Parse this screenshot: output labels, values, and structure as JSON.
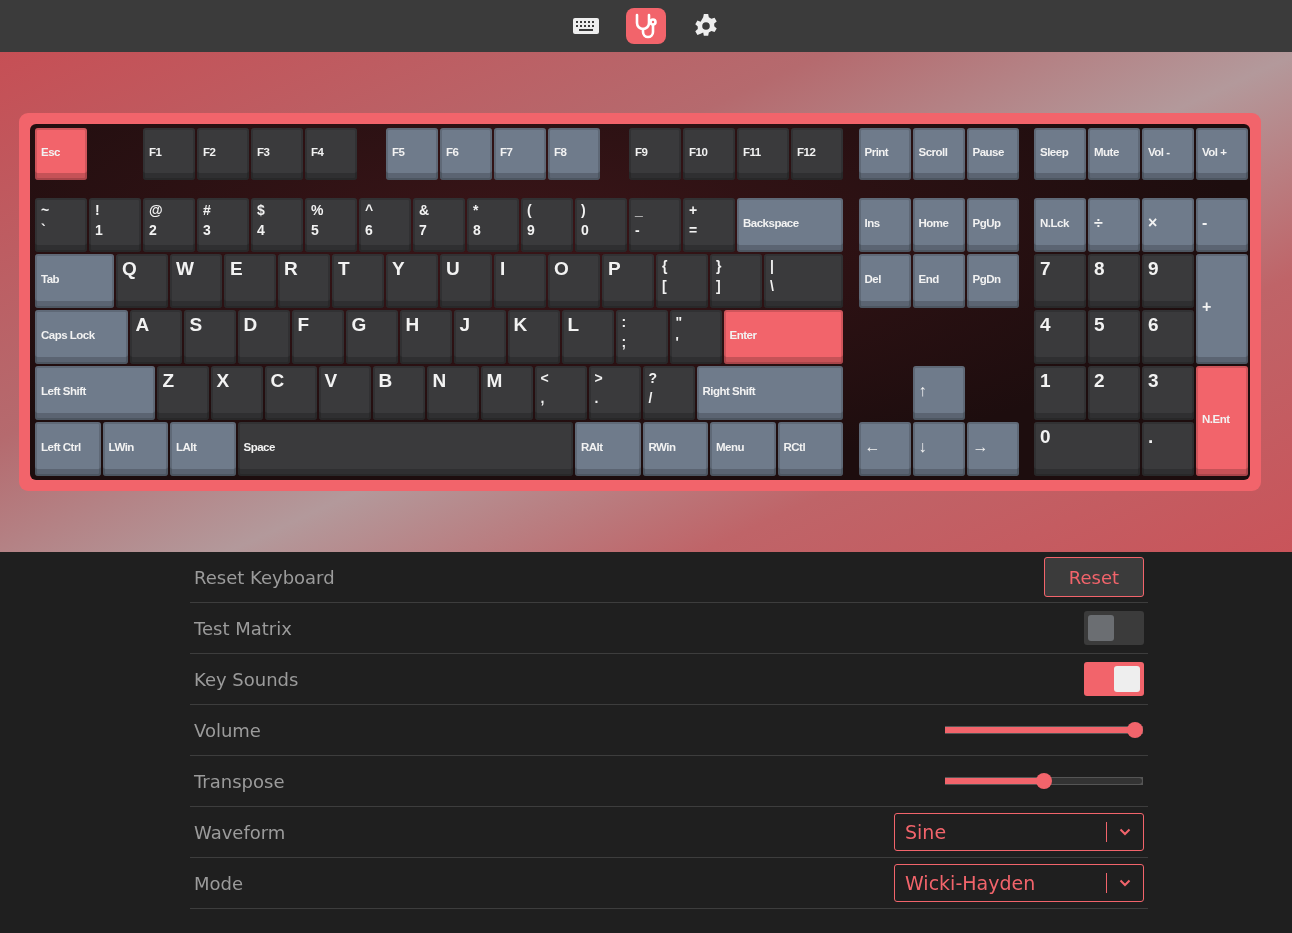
{
  "tabs": [
    {
      "selected": false
    },
    {
      "selected": true
    },
    {
      "selected": false
    }
  ],
  "keyboard": {
    "function_row": [
      {
        "label": "Esc",
        "kind": "fn",
        "color": "#f2646b"
      },
      {
        "label": "F1",
        "kind": "fn",
        "color": "#3a3a3c"
      },
      {
        "label": "F2",
        "kind": "fn",
        "color": "#3a3a3c"
      },
      {
        "label": "F3",
        "kind": "fn",
        "color": "#3a3a3c"
      },
      {
        "label": "F4",
        "kind": "fn",
        "color": "#3a3a3c"
      },
      {
        "label": "F5",
        "kind": "fn",
        "color": "#6f7b8b"
      },
      {
        "label": "F6",
        "kind": "fn",
        "color": "#6f7b8b"
      },
      {
        "label": "F7",
        "kind": "fn",
        "color": "#6f7b8b"
      },
      {
        "label": "F8",
        "kind": "fn",
        "color": "#6f7b8b"
      },
      {
        "label": "F9",
        "kind": "fn",
        "color": "#3a3a3c"
      },
      {
        "label": "F10",
        "kind": "fn",
        "color": "#3a3a3c"
      },
      {
        "label": "F11",
        "kind": "fn",
        "color": "#3a3a3c"
      },
      {
        "label": "F12",
        "kind": "fn",
        "color": "#3a3a3c"
      },
      {
        "label": "Print",
        "kind": "fn",
        "color": "#6f7b8b"
      },
      {
        "label": "Scroll",
        "kind": "fn",
        "color": "#6f7b8b"
      },
      {
        "label": "Pause",
        "kind": "fn",
        "color": "#6f7b8b"
      },
      {
        "label": "Sleep",
        "kind": "fn",
        "color": "#6f7b8b"
      },
      {
        "label": "Mute",
        "kind": "fn",
        "color": "#6f7b8b"
      },
      {
        "label": "Vol -",
        "kind": "fn",
        "color": "#6f7b8b"
      },
      {
        "label": "Vol +",
        "kind": "fn",
        "color": "#6f7b8b"
      }
    ],
    "main": [
      [
        {
          "shift": "~",
          "label": "`",
          "kind": "dual",
          "color": "#3a3a3c"
        },
        {
          "shift": "!",
          "label": "1",
          "kind": "dual",
          "color": "#3a3a3c"
        },
        {
          "shift": "@",
          "label": "2",
          "kind": "dual",
          "color": "#3a3a3c"
        },
        {
          "shift": "#",
          "label": "3",
          "kind": "dual",
          "color": "#3a3a3c"
        },
        {
          "shift": "$",
          "label": "4",
          "kind": "dual",
          "color": "#3a3a3c"
        },
        {
          "shift": "%",
          "label": "5",
          "kind": "dual",
          "color": "#3a3a3c"
        },
        {
          "shift": "^",
          "label": "6",
          "kind": "dual",
          "color": "#3a3a3c"
        },
        {
          "shift": "&",
          "label": "7",
          "kind": "dual",
          "color": "#3a3a3c"
        },
        {
          "shift": "*",
          "label": "8",
          "kind": "dual",
          "color": "#3a3a3c"
        },
        {
          "shift": "(",
          "label": "9",
          "kind": "dual",
          "color": "#3a3a3c"
        },
        {
          "shift": ")",
          "label": "0",
          "kind": "dual",
          "color": "#3a3a3c"
        },
        {
          "shift": "_",
          "label": "-",
          "kind": "dual",
          "color": "#3a3a3c"
        },
        {
          "shift": "+",
          "label": "=",
          "kind": "dual",
          "color": "#3a3a3c"
        },
        {
          "label": "Backspace",
          "kind": "fn",
          "color": "#6f7b8b"
        }
      ],
      [
        {
          "label": "Tab",
          "kind": "fn",
          "color": "#6f7b8b"
        },
        {
          "label": "Q",
          "kind": "char",
          "color": "#3a3a3c"
        },
        {
          "label": "W",
          "kind": "char",
          "color": "#3a3a3c"
        },
        {
          "label": "E",
          "kind": "char",
          "color": "#3a3a3c"
        },
        {
          "label": "R",
          "kind": "char",
          "color": "#3a3a3c"
        },
        {
          "label": "T",
          "kind": "char",
          "color": "#3a3a3c"
        },
        {
          "label": "Y",
          "kind": "char",
          "color": "#3a3a3c"
        },
        {
          "label": "U",
          "kind": "char",
          "color": "#3a3a3c"
        },
        {
          "label": "I",
          "kind": "char",
          "color": "#3a3a3c"
        },
        {
          "label": "O",
          "kind": "char",
          "color": "#3a3a3c"
        },
        {
          "label": "P",
          "kind": "char",
          "color": "#3a3a3c"
        },
        {
          "shift": "{",
          "label": "[",
          "kind": "dual",
          "color": "#3a3a3c"
        },
        {
          "shift": "}",
          "label": "]",
          "kind": "dual",
          "color": "#3a3a3c"
        },
        {
          "shift": "|",
          "label": "\\",
          "kind": "dual",
          "color": "#3a3a3c"
        }
      ],
      [
        {
          "label": "Caps Lock",
          "kind": "fn",
          "color": "#6f7b8b"
        },
        {
          "label": "A",
          "kind": "char",
          "color": "#3a3a3c"
        },
        {
          "label": "S",
          "kind": "char",
          "color": "#3a3a3c"
        },
        {
          "label": "D",
          "kind": "char",
          "color": "#3a3a3c"
        },
        {
          "label": "F",
          "kind": "char",
          "color": "#3a3a3c"
        },
        {
          "label": "G",
          "kind": "char",
          "color": "#3a3a3c"
        },
        {
          "label": "H",
          "kind": "char",
          "color": "#3a3a3c"
        },
        {
          "label": "J",
          "kind": "char",
          "color": "#3a3a3c"
        },
        {
          "label": "K",
          "kind": "char",
          "color": "#3a3a3c"
        },
        {
          "label": "L",
          "kind": "char",
          "color": "#3a3a3c"
        },
        {
          "shift": ":",
          "label": ";",
          "kind": "dual",
          "color": "#3a3a3c"
        },
        {
          "shift": "\"",
          "label": "'",
          "kind": "dual",
          "color": "#3a3a3c"
        },
        {
          "label": "Enter",
          "kind": "fn",
          "color": "#f2646b"
        }
      ],
      [
        {
          "label": "Left Shift",
          "kind": "fn",
          "color": "#6f7b8b"
        },
        {
          "label": "Z",
          "kind": "char",
          "color": "#3a3a3c"
        },
        {
          "label": "X",
          "kind": "char",
          "color": "#3a3a3c"
        },
        {
          "label": "C",
          "kind": "char",
          "color": "#3a3a3c"
        },
        {
          "label": "V",
          "kind": "char",
          "color": "#3a3a3c"
        },
        {
          "label": "B",
          "kind": "char",
          "color": "#3a3a3c"
        },
        {
          "label": "N",
          "kind": "char",
          "color": "#3a3a3c"
        },
        {
          "label": "M",
          "kind": "char",
          "color": "#3a3a3c"
        },
        {
          "shift": "<",
          "label": ",",
          "kind": "dual",
          "color": "#3a3a3c"
        },
        {
          "shift": ">",
          "label": ".",
          "kind": "dual",
          "color": "#3a3a3c"
        },
        {
          "shift": "?",
          "label": "/",
          "kind": "dual",
          "color": "#3a3a3c"
        },
        {
          "label": "Right Shift",
          "kind": "fn",
          "color": "#6f7b8b"
        }
      ],
      [
        {
          "label": "Left Ctrl",
          "kind": "fn",
          "color": "#6f7b8b"
        },
        {
          "label": "LWin",
          "kind": "fn",
          "color": "#6f7b8b"
        },
        {
          "label": "LAlt",
          "kind": "fn",
          "color": "#6f7b8b"
        },
        {
          "label": "Space",
          "kind": "fn",
          "color": "#3a3a3c"
        },
        {
          "label": "RAlt",
          "kind": "fn",
          "color": "#6f7b8b"
        },
        {
          "label": "RWin",
          "kind": "fn",
          "color": "#6f7b8b"
        },
        {
          "label": "Menu",
          "kind": "fn",
          "color": "#6f7b8b"
        },
        {
          "label": "RCtl",
          "kind": "fn",
          "color": "#6f7b8b"
        }
      ]
    ],
    "navigation": [
      {
        "label": "Ins",
        "kind": "fn",
        "color": "#6f7b8b"
      },
      {
        "label": "Home",
        "kind": "fn",
        "color": "#6f7b8b"
      },
      {
        "label": "PgUp",
        "kind": "fn",
        "color": "#6f7b8b"
      },
      {
        "label": "Del",
        "kind": "fn",
        "color": "#6f7b8b"
      },
      {
        "label": "End",
        "kind": "fn",
        "color": "#6f7b8b"
      },
      {
        "label": "PgDn",
        "kind": "fn",
        "color": "#6f7b8b"
      },
      {
        "label": "↑",
        "kind": "sym",
        "color": "#6f7b8b"
      },
      {
        "label": "←",
        "kind": "sym",
        "color": "#6f7b8b"
      },
      {
        "label": "↓",
        "kind": "sym",
        "color": "#6f7b8b"
      },
      {
        "label": "→",
        "kind": "sym",
        "color": "#6f7b8b"
      }
    ],
    "numpad": [
      {
        "label": "N.Lck",
        "kind": "fn",
        "color": "#6f7b8b"
      },
      {
        "label": "÷",
        "kind": "sym",
        "color": "#6f7b8b"
      },
      {
        "label": "×",
        "kind": "sym",
        "color": "#6f7b8b"
      },
      {
        "label": "-",
        "kind": "sym",
        "color": "#6f7b8b"
      },
      {
        "label": "7",
        "kind": "char",
        "color": "#3a3a3c"
      },
      {
        "label": "8",
        "kind": "char",
        "color": "#3a3a3c"
      },
      {
        "label": "9",
        "kind": "char",
        "color": "#3a3a3c"
      },
      {
        "label": "+",
        "kind": "sym",
        "color": "#6f7b8b"
      },
      {
        "label": "4",
        "kind": "char",
        "color": "#3a3a3c"
      },
      {
        "label": "5",
        "kind": "char",
        "color": "#3a3a3c"
      },
      {
        "label": "6",
        "kind": "char",
        "color": "#3a3a3c"
      },
      {
        "label": "1",
        "kind": "char",
        "color": "#3a3a3c"
      },
      {
        "label": "2",
        "kind": "char",
        "color": "#3a3a3c"
      },
      {
        "label": "3",
        "kind": "char",
        "color": "#3a3a3c"
      },
      {
        "label": "N.Ent",
        "kind": "fn",
        "color": "#f2646b"
      },
      {
        "label": "0",
        "kind": "char",
        "color": "#3a3a3c"
      },
      {
        "label": ".",
        "kind": "char",
        "color": "#3a3a3c"
      }
    ]
  },
  "settings": [
    {
      "kind": "button",
      "label": "Reset Keyboard",
      "button": "Reset"
    },
    {
      "kind": "toggle",
      "label": "Test Matrix",
      "on": false
    },
    {
      "kind": "toggle",
      "label": "Key Sounds",
      "on": true
    },
    {
      "kind": "slider",
      "label": "Volume",
      "level": 1.0
    },
    {
      "kind": "slider",
      "label": "Transpose",
      "level": 0.5
    },
    {
      "kind": "select",
      "label": "Waveform",
      "value": "Sine"
    },
    {
      "kind": "select",
      "label": "Mode",
      "value": "Wicki-Hayden"
    }
  ]
}
